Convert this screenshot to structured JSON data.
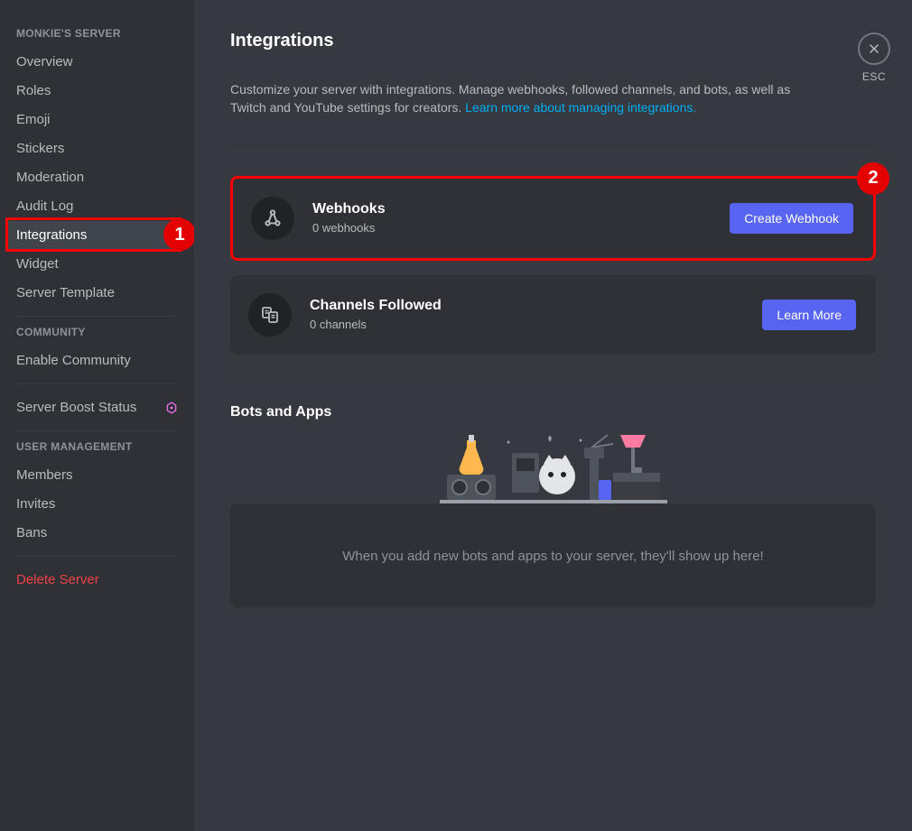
{
  "sidebar": {
    "header1": "MONKIE'S SERVER",
    "items1": [
      {
        "label": "Overview"
      },
      {
        "label": "Roles"
      },
      {
        "label": "Emoji"
      },
      {
        "label": "Stickers"
      },
      {
        "label": "Moderation"
      },
      {
        "label": "Audit Log"
      },
      {
        "label": "Integrations"
      },
      {
        "label": "Widget"
      },
      {
        "label": "Server Template"
      }
    ],
    "header2": "COMMUNITY",
    "items2": [
      {
        "label": "Enable Community"
      }
    ],
    "boost_label": "Server Boost Status",
    "header3": "USER MANAGEMENT",
    "items3": [
      {
        "label": "Members"
      },
      {
        "label": "Invites"
      },
      {
        "label": "Bans"
      }
    ],
    "delete_label": "Delete Server"
  },
  "content": {
    "title": "Integrations",
    "desc_pre": "Customize your server with integrations. Manage webhooks, followed channels, and bots, as well as Twitch and YouTube settings for creators. ",
    "desc_link": "Learn more about managing integrations.",
    "webhooks": {
      "title": "Webhooks",
      "sub": "0 webhooks",
      "button": "Create Webhook"
    },
    "channels": {
      "title": "Channels Followed",
      "sub": "0 channels",
      "button": "Learn More"
    },
    "bots_header": "Bots and Apps",
    "bots_empty": "When you add new bots and apps to your server, they'll show up here!",
    "close_label": "ESC"
  },
  "annotations": {
    "badge1": "1",
    "badge2": "2"
  }
}
